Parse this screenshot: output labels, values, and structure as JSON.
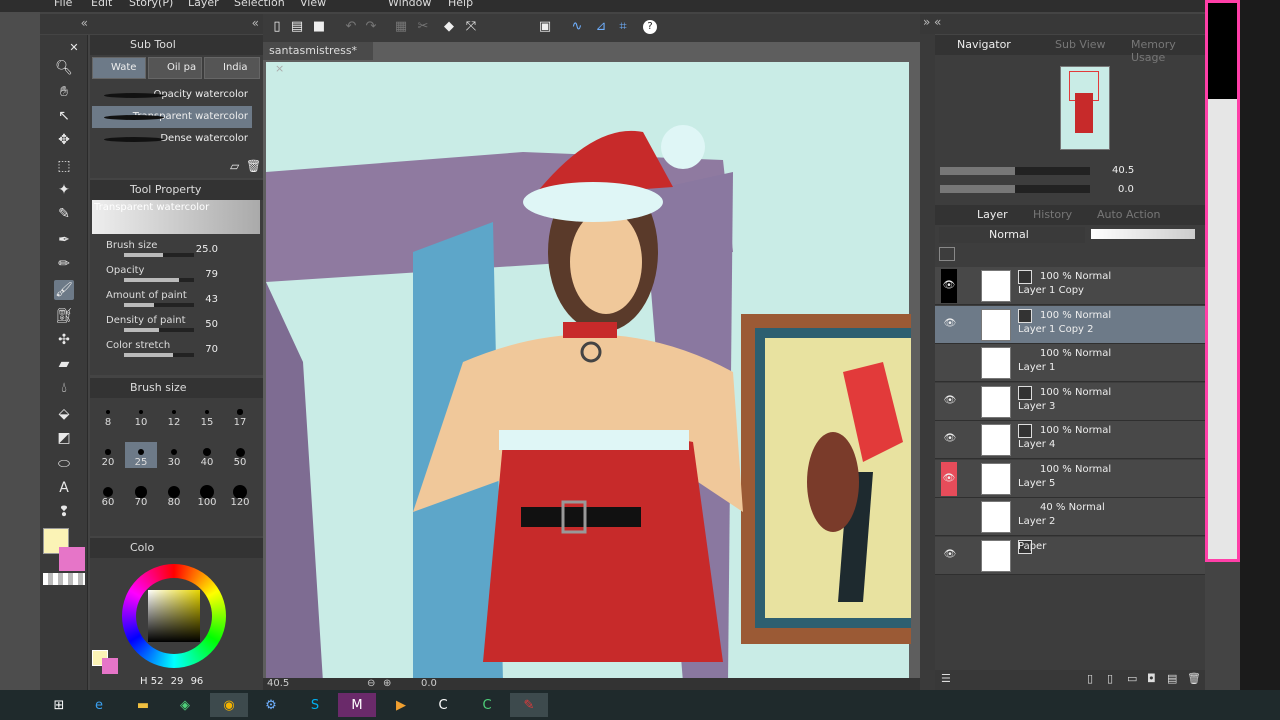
{
  "menu": [
    "File",
    "Edit",
    "Story(P)",
    "Layer",
    "Selection",
    "View",
    "Window",
    "Help"
  ],
  "document": {
    "tab_title": "santasmistress*",
    "close": "×"
  },
  "subtool": {
    "header": "Sub Tool",
    "tabs": [
      "Wate",
      "Oil pa",
      "India"
    ],
    "brushes": [
      "Opacity watercolor",
      "Transparent watercolor",
      "Dense watercolor"
    ]
  },
  "tool_property": {
    "header": "Tool Property",
    "preset_name": "Transparent watercolor",
    "props": [
      {
        "label": "Brush size",
        "value": "25.0",
        "level": 0.55
      },
      {
        "label": "Opacity",
        "value": "79",
        "level": 0.79
      },
      {
        "label": "Amount of paint",
        "value": "43",
        "level": 0.43
      },
      {
        "label": "Density of paint",
        "value": "50",
        "level": 0.5
      },
      {
        "label": "Color stretch",
        "value": "70",
        "level": 0.7
      }
    ]
  },
  "brush_size_panel": {
    "header": "Brush size",
    "sizes": [
      "8",
      "10",
      "12",
      "15",
      "17",
      "20",
      "25",
      "30",
      "40",
      "50",
      "60",
      "70",
      "80",
      "100",
      "120"
    ]
  },
  "color_panel": {
    "header": "Colo",
    "readout": {
      "h": "52",
      "s": "29",
      "v": "96"
    },
    "h_label": "H",
    "main_color": "#fbf3b6",
    "sub_color": "#e675c8"
  },
  "canvas_status": {
    "zoom": "40.5",
    "angle": "0.0"
  },
  "navigator": {
    "header": "Navigator",
    "tabs": [
      "Sub View",
      "Memory Usage"
    ],
    "zoom": "40.5",
    "rotation": "0.0"
  },
  "layer_panel": {
    "header": "Layer",
    "tabs": [
      "History",
      "Auto Action"
    ],
    "blend_mode": "Normal",
    "layers": [
      {
        "opacity": "100 %",
        "mode": "Normal",
        "name": "Layer 1 Copy",
        "visible": false,
        "selected": false,
        "raster_icon": true
      },
      {
        "opacity": "100 %",
        "mode": "Normal",
        "name": "Layer 1 Copy 2",
        "visible": true,
        "selected": true,
        "raster_icon": true
      },
      {
        "opacity": "100 %",
        "mode": "Normal",
        "name": "Layer 1",
        "visible": false,
        "selected": false,
        "raster_icon": false
      },
      {
        "opacity": "100 %",
        "mode": "Normal",
        "name": "Layer 3",
        "visible": true,
        "selected": false,
        "raster_icon": true
      },
      {
        "opacity": "100 %",
        "mode": "Normal",
        "name": "Layer 4",
        "visible": true,
        "selected": false,
        "raster_icon": true
      },
      {
        "opacity": "100 %",
        "mode": "Normal",
        "name": "Layer 5",
        "visible": true,
        "selected": false,
        "raster_icon": false
      },
      {
        "opacity": "40 %",
        "mode": "Normal",
        "name": "Layer 2",
        "visible": false,
        "selected": false,
        "raster_icon": false
      },
      {
        "opacity": "",
        "mode": "",
        "name": "Paper",
        "visible": true,
        "selected": false,
        "raster_icon": true
      }
    ]
  },
  "colors": {
    "accent": "#6d7a88",
    "pink": "#ff3fa8",
    "layer5_eye": "#e74c5a"
  }
}
